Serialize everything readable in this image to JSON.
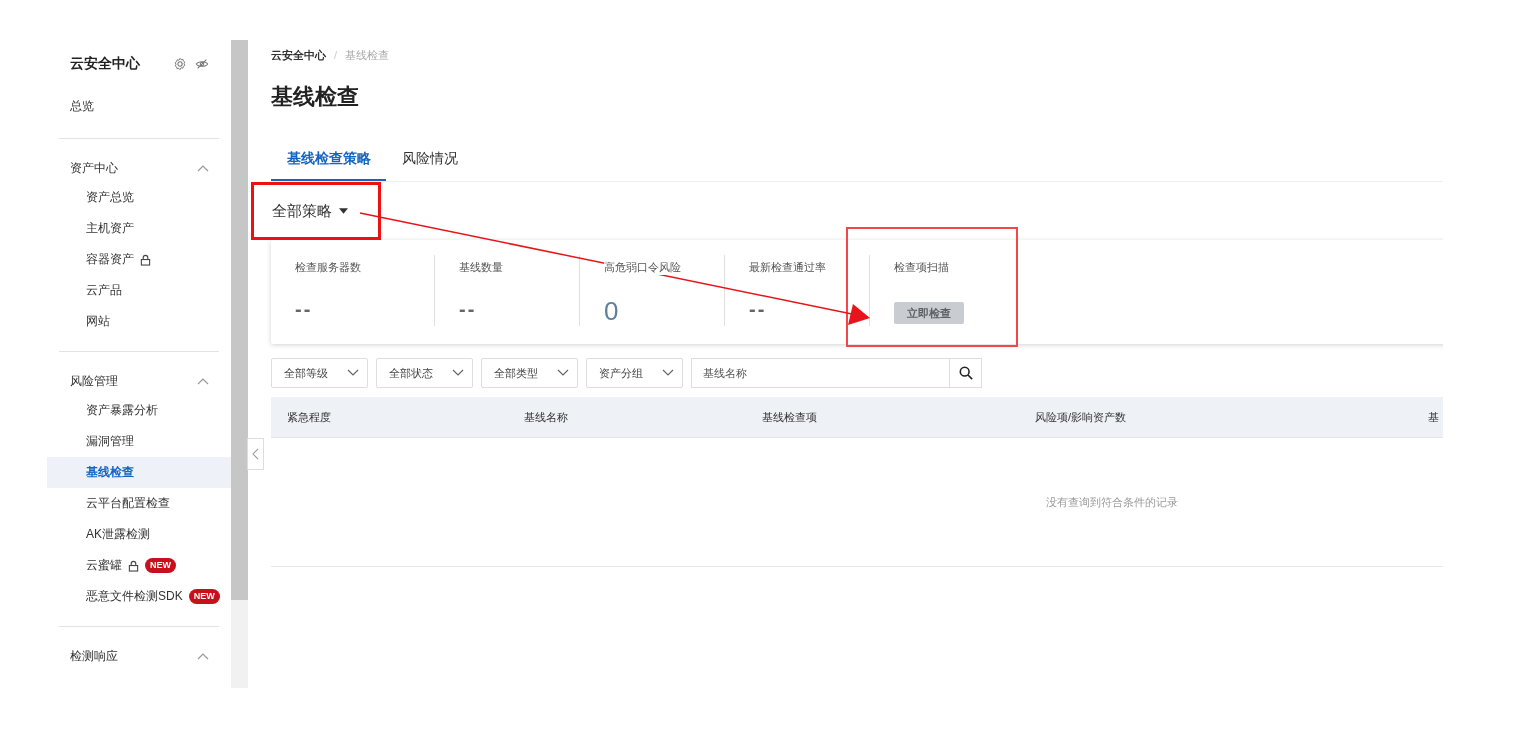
{
  "sidebar": {
    "title": "云安全中心",
    "overview": "总览",
    "groups": [
      {
        "label": "资产中心",
        "expanded": true,
        "items": [
          {
            "label": "资产总览",
            "selected": false,
            "locked": false
          },
          {
            "label": "主机资产",
            "selected": false,
            "locked": false
          },
          {
            "label": "容器资产",
            "selected": false,
            "locked": true
          },
          {
            "label": "云产品",
            "selected": false,
            "locked": false
          },
          {
            "label": "网站",
            "selected": false,
            "locked": false
          }
        ]
      },
      {
        "label": "风险管理",
        "expanded": true,
        "items": [
          {
            "label": "资产暴露分析",
            "selected": false,
            "locked": false
          },
          {
            "label": "漏洞管理",
            "selected": false,
            "locked": false
          },
          {
            "label": "基线检查",
            "selected": true,
            "locked": false
          },
          {
            "label": "云平台配置检查",
            "selected": false,
            "locked": false
          },
          {
            "label": "AK泄露检测",
            "selected": false,
            "locked": false
          },
          {
            "label": "云蜜罐",
            "selected": false,
            "locked": true,
            "badge": "NEW"
          },
          {
            "label": "恶意文件检测SDK",
            "selected": false,
            "locked": false,
            "badge": "NEW"
          }
        ]
      },
      {
        "label": "检测响应",
        "expanded": true
      }
    ]
  },
  "breadcrumb": [
    "云安全中心",
    "基线检查"
  ],
  "breadcrumb_separator": "/",
  "page_title": "基线检查",
  "tabs": [
    {
      "label": "基线检查策略",
      "selected": true
    },
    {
      "label": "风险情况",
      "selected": false
    }
  ],
  "policy_dropdown": "全部策略",
  "stats": [
    {
      "kind": "value",
      "label": "检查服务器数",
      "value": "--"
    },
    {
      "kind": "value",
      "label": "基线数量",
      "value": "--"
    },
    {
      "kind": "value",
      "label": "高危弱口令风险",
      "value": "0"
    },
    {
      "kind": "value",
      "label": "最新检查通过率",
      "value": "--"
    },
    {
      "kind": "action",
      "label": "检查项扫描",
      "button": "立即检查",
      "disabled": true
    }
  ],
  "filters": [
    "全部等级",
    "全部状态",
    "全部类型",
    "资产分组"
  ],
  "search": {
    "placeholder": "基线名称"
  },
  "table": {
    "columns": [
      "紧急程度",
      "基线名称",
      "基线检查项",
      "风险项/影响资产数",
      "基"
    ],
    "empty_text": "没有查询到符合条件的记录"
  }
}
